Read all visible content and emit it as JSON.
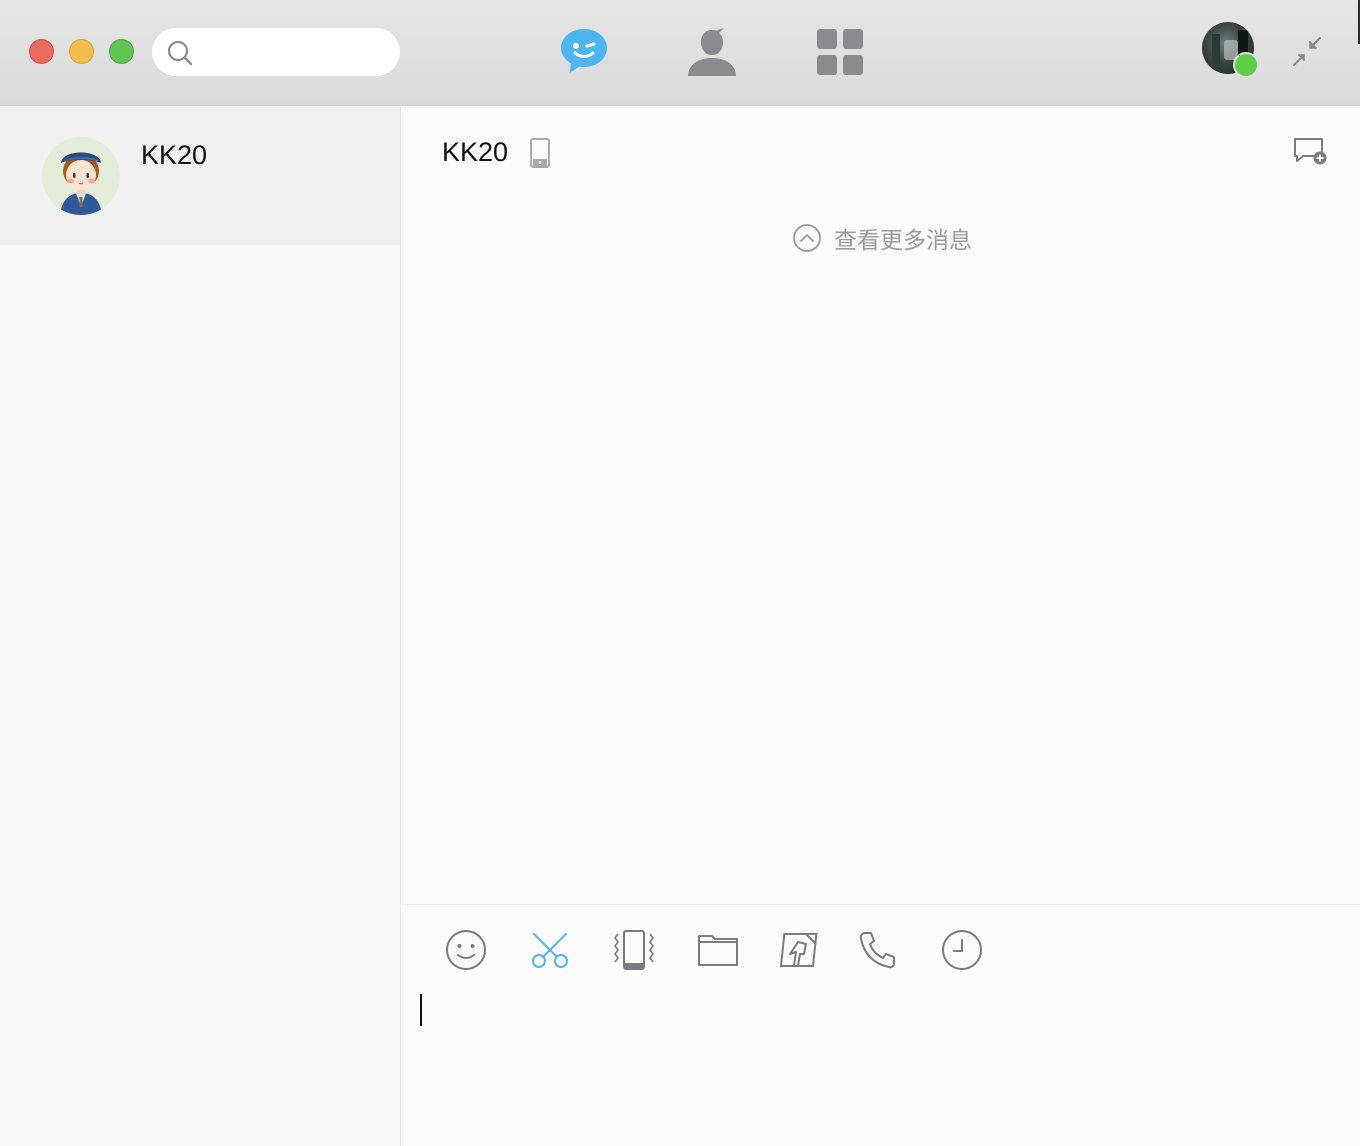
{
  "window": {
    "controls": [
      "close",
      "minimize",
      "maximize"
    ]
  },
  "search": {
    "value": "",
    "placeholder": ""
  },
  "nav": {
    "tabs": [
      {
        "icon": "chat-bubble-icon",
        "active": true,
        "color": "#4db6f0"
      },
      {
        "icon": "contacts-icon",
        "active": false,
        "color": "#8a8a8f"
      },
      {
        "icon": "apps-grid-icon",
        "active": false,
        "color": "#8a8a8f"
      }
    ]
  },
  "profile": {
    "status": "online",
    "status_color": "#5bd044"
  },
  "conversations": [
    {
      "name": "KK20",
      "avatar": "boy-with-beret-avatar",
      "selected": true
    }
  ],
  "chat": {
    "title": "KK20",
    "device_icon": "mobile-device-icon",
    "load_more_label": "查看更多消息"
  },
  "toolbar": {
    "tools": [
      {
        "icon": "emoji-icon"
      },
      {
        "icon": "screenshot-scissors-icon",
        "color": "#4db6f0"
      },
      {
        "icon": "vibrate-shake-icon"
      },
      {
        "icon": "folder-icon"
      },
      {
        "icon": "screen-capture-icon"
      },
      {
        "icon": "phone-call-icon"
      },
      {
        "icon": "history-clock-icon"
      }
    ]
  },
  "composer": {
    "value": ""
  }
}
